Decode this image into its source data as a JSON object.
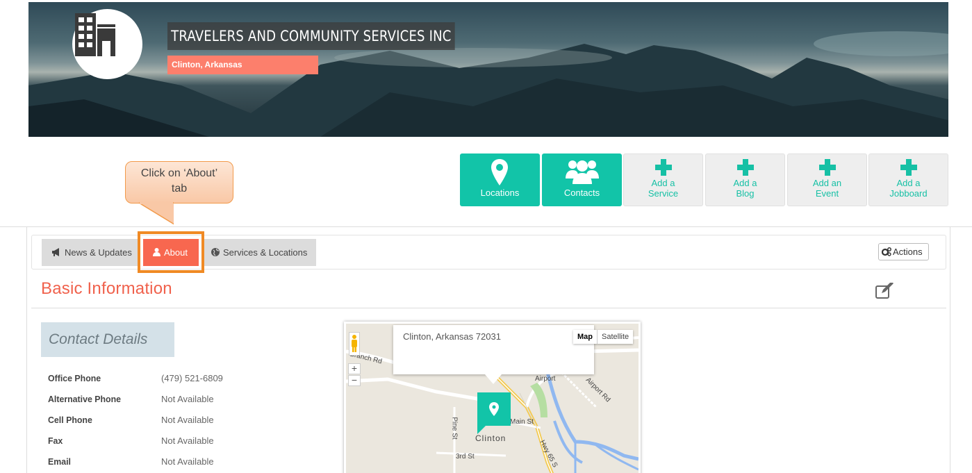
{
  "banner": {
    "title": "TRAVELERS AND COMMUNITY SERVICES INC",
    "location": "Clinton, Arkansas",
    "logo_icon": "building-icon"
  },
  "actions": [
    {
      "label": "Locations",
      "icon": "map-marker-icon",
      "style": "teal"
    },
    {
      "label": "Contacts",
      "icon": "users-icon",
      "style": "teal"
    },
    {
      "line1": "Add a",
      "line2": "Service",
      "icon": "plus-icon",
      "style": "grey"
    },
    {
      "line1": "Add a",
      "line2": "Blog",
      "icon": "plus-icon",
      "style": "grey"
    },
    {
      "line1": "Add an",
      "line2": "Event",
      "icon": "plus-icon",
      "style": "grey"
    },
    {
      "line1": "Add a",
      "line2": "Jobboard",
      "icon": "plus-icon",
      "style": "grey"
    }
  ],
  "callout": {
    "line1": "Click on ‘About’",
    "line2": "tab"
  },
  "tabs": [
    {
      "label": "News & Updates",
      "icon": "bullhorn-icon"
    },
    {
      "label": "About",
      "icon": "user-icon",
      "active": true
    },
    {
      "label": "Services & Locations",
      "icon": "globe-icon"
    }
  ],
  "actions_button": "Actions",
  "section_title": "Basic Information",
  "contact": {
    "heading": "Contact Details",
    "rows": [
      {
        "label": "Office Phone",
        "value": "(479) 521-6809"
      },
      {
        "label": "Alternative Phone",
        "value": "Not Available"
      },
      {
        "label": "Cell Phone",
        "value": "Not Available"
      },
      {
        "label": "Fax",
        "value": "Not Available"
      },
      {
        "label": "Email",
        "value": "Not Available"
      }
    ]
  },
  "map": {
    "info_text": "Clinton, Arkansas 72031",
    "type_map": "Map",
    "type_satellite": "Satellite",
    "zoom_in": "+",
    "zoom_out": "−",
    "labels": {
      "branch_rd": "Branch Rd",
      "airport": "Airport",
      "airport_rd": "Airport Rd",
      "pine_st": "Pine St",
      "main_st": "Main St",
      "clinton": "Clinton",
      "hwy65": "Hwy 65 S",
      "third_st": "3rd St"
    }
  },
  "colors": {
    "teal": "#12c4a8",
    "coral": "#f8674f",
    "highlight": "#f08a24"
  }
}
